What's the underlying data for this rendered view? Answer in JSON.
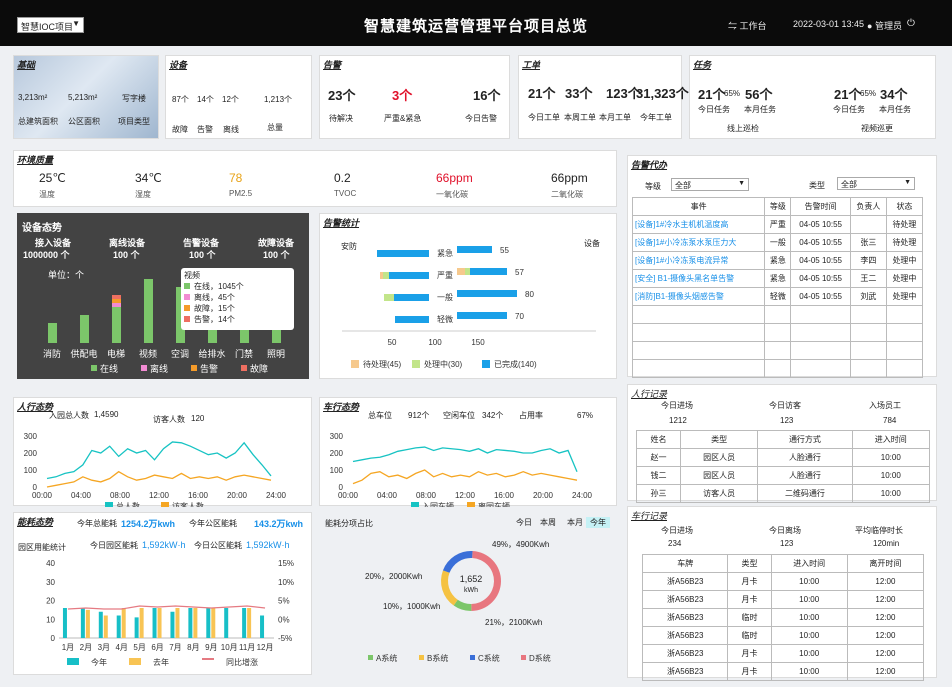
{
  "header": {
    "project": "智慧IOC项目",
    "title": "智慧建筑运营管理平台项目总览",
    "workbench": "工作台",
    "datetime": "2022-03-01 13:45",
    "user": "管理员"
  },
  "basic": {
    "title": "基础",
    "area_total": "3,213m²",
    "area_public": "5,213m²",
    "type": "写字楼",
    "l_total": "总建筑面积",
    "l_public": "公区面积",
    "l_type": "项目类型"
  },
  "device": {
    "title": "设备",
    "v1": "87个",
    "v2": "14个",
    "v3": "12个",
    "v4": "1,213个",
    "l1": "故障",
    "l2": "告警",
    "l3": "离线",
    "l4": "总量"
  },
  "alarm": {
    "title": "告警",
    "v1": "23个",
    "v2": "3个",
    "v3": "16个",
    "l1": "待解决",
    "l2": "严重&紧急",
    "l3": "今日告警"
  },
  "workorder": {
    "title": "工单",
    "v1": "21个",
    "v2": "33个",
    "v3": "123个",
    "v4": "31,323个",
    "l1": "今日工单",
    "l2": "本周工单",
    "l3": "本月工单",
    "l4": "今年工单"
  },
  "task": {
    "title": "任务",
    "a1": "21个",
    "ap": "65%",
    "a2": "56个",
    "al1": "今日任务",
    "al2": "本月任务",
    "acap": "线上巡检",
    "b1": "21个",
    "bp": "65%",
    "b2": "34个",
    "bl1": "今日任务",
    "bl2": "本月任务",
    "bcap": "视频巡更"
  },
  "env": {
    "title": "环境质量",
    "items": [
      {
        "v": "25℃",
        "l": "温度",
        "c": "#222"
      },
      {
        "v": "34℃",
        "l": "湿度",
        "c": "#222"
      },
      {
        "v": "78",
        "l": "PM2.5",
        "c": "#e8a317"
      },
      {
        "v": "0.2",
        "l": "TVOC",
        "c": "#222"
      },
      {
        "v": "66ppm",
        "l": "一氧化碳",
        "c": "#e0102a"
      },
      {
        "v": "66ppm",
        "l": "二氧化碳",
        "c": "#222"
      }
    ]
  },
  "devstatus": {
    "title": "设备态势",
    "k1": "接入设备",
    "k2": "离线设备",
    "k3": "告警设备",
    "k4": "故障设备",
    "v1": "1000000 个",
    "v2": "100 个",
    "v3": "100 个",
    "v4": "100 个",
    "unit": "单位：个",
    "tooltip": {
      "title": "视频",
      "rows": [
        "在线，1045个",
        "离线，45个",
        "故障，15个",
        "告警，14个"
      ]
    },
    "legend": [
      "在线",
      "离线",
      "告警",
      "故障"
    ],
    "colors": [
      "#7cc66a",
      "#f28bd3",
      "#f59b2a",
      "#ee6f61"
    ]
  },
  "alarmstats": {
    "title": "告警统计",
    "left": "安防",
    "right": "设备",
    "levels": [
      "紧急",
      "严重",
      "一般",
      "轻微"
    ],
    "right_values": [
      "55",
      "57",
      "80",
      "70"
    ],
    "axis": [
      "50",
      "100",
      "150"
    ],
    "legend": [
      "待处理(45)",
      "处理中(30)",
      "已完成(140)"
    ],
    "colors": [
      "#f6c98d",
      "#c2e58a",
      "#1aa0e8"
    ]
  },
  "todo": {
    "title": "告警代办",
    "f1": "等级",
    "f1v": "全部",
    "f2": "类型",
    "f2v": "全部",
    "cols": [
      "事件",
      "等级",
      "告警时间",
      "负责人",
      "状态"
    ],
    "rows": [
      [
        "[设备]1#冷水主机机温度高",
        "严重",
        "04-05 10:55",
        "",
        "待处理"
      ],
      [
        "[设备]1#小冷冻泵水泵压力大",
        "一般",
        "04-05 10:55",
        "张三",
        "待处理"
      ],
      [
        "[设备]1#小冷冻泵电流异常",
        "紧急",
        "04-05 10:55",
        "李四",
        "处理中"
      ],
      [
        "[安全] B1-摄像头黑名单告警",
        "紧急",
        "04-05 10:55",
        "王二",
        "处理中"
      ],
      [
        "[消防]B1-摄像头烟感告警",
        "轻微",
        "04-05 10:55",
        "刘武",
        "处理中"
      ]
    ]
  },
  "people": {
    "title": "人行态势",
    "total_label": "入园总人数",
    "total": "1,4590",
    "visit_label": "访客人数",
    "visit": "120",
    "yticks": [
      "300",
      "200",
      "100",
      "0"
    ],
    "xticks": [
      "00:00",
      "04:00",
      "08:00",
      "12:00",
      "16:00",
      "20:00",
      "24:00"
    ],
    "legend": [
      "总人数",
      "访客人数"
    ]
  },
  "vehicle": {
    "title": "车行态势",
    "total_label": "总车位",
    "total": "912个",
    "free_label": "空闲车位",
    "free": "342个",
    "rate_label": "占用率",
    "rate": "67%",
    "yticks": [
      "300",
      "200",
      "100",
      "0"
    ],
    "xticks": [
      "00:00",
      "04:00",
      "08:00",
      "12:00",
      "16:00",
      "20:00",
      "24:00"
    ],
    "legend": [
      "入园车辆",
      "离园车辆"
    ]
  },
  "energy": {
    "title": "能耗态势",
    "yl": "今年总能耗",
    "yv": "1254.2万kwh",
    "pl": "今年公区能耗",
    "pv": "143.2万kwh",
    "sub": "园区用能统计",
    "tl": "今日园区能耗",
    "tv": "1,592kW·h",
    "tpl": "今日公区能耗",
    "tpv": "1,592kW·h",
    "yticks": [
      "40",
      "30",
      "20",
      "10",
      "0"
    ],
    "rticks": [
      "15%",
      "10%",
      "5%",
      "0%",
      "-5%"
    ],
    "months": [
      "1月",
      "2月",
      "3月",
      "4月",
      "5月",
      "6月",
      "7月",
      "8月",
      "9月",
      "10月",
      "11月",
      "12月"
    ],
    "legend": [
      "今年",
      "去年",
      "同比增涨"
    ]
  },
  "split": {
    "title": "能耗分项占比",
    "tabs": [
      "今日",
      "本周",
      "本月",
      "今年"
    ],
    "center": "1,652",
    "unit": "kWh",
    "l1": "49%，4900Kwh",
    "l2": "20%，2000Kwh",
    "l3": "10%，1000Kwh",
    "l4": "21%，2100Kwh",
    "legend": [
      "A系统",
      "B系统",
      "C系统",
      "D系统"
    ],
    "colors": [
      "#7cc66a",
      "#f5c242",
      "#3a6fd8",
      "#e8767f"
    ]
  },
  "peoplerec": {
    "title": "人行记录",
    "k1": "今日进场",
    "k2": "今日访客",
    "k3": "入场员工",
    "v1": "1212",
    "v2": "123",
    "v3": "784",
    "cols": [
      "姓名",
      "类型",
      "通行方式",
      "进入时间"
    ],
    "rows": [
      [
        "赵一",
        "园区人员",
        "人脸通行",
        "10:00"
      ],
      [
        "钱二",
        "园区人员",
        "人脸通行",
        "10:00"
      ],
      [
        "孙三",
        "访客人员",
        "二维码通行",
        "10:00"
      ]
    ]
  },
  "carrec": {
    "title": "车行记录",
    "k1": "今日进场",
    "k2": "今日离场",
    "k3": "平均临停时长",
    "v1": "234",
    "v2": "123",
    "v3": "120min",
    "cols": [
      "车牌",
      "类型",
      "进入时间",
      "离开时间"
    ],
    "rows": [
      [
        "浙A56B23",
        "月卡",
        "10:00",
        "12:00"
      ],
      [
        "浙A56B23",
        "月卡",
        "10:00",
        "12:00"
      ],
      [
        "浙A56B23",
        "临时",
        "10:00",
        "12:00"
      ],
      [
        "浙A56B23",
        "临时",
        "10:00",
        "12:00"
      ],
      [
        "浙A56B23",
        "月卡",
        "10:00",
        "12:00"
      ],
      [
        "浙A56B23",
        "月卡",
        "10:00",
        "12:00"
      ]
    ]
  },
  "chart_data": [
    {
      "type": "bar",
      "name": "设备态势",
      "categories": [
        "消防",
        "供配电",
        "电梯",
        "视频",
        "空调",
        "给排水",
        "门禁",
        "照明"
      ],
      "series": [
        {
          "name": "在线",
          "values": [
            10,
            14,
            18,
            32,
            28,
            22,
            14,
            12
          ]
        },
        {
          "name": "离线",
          "values": [
            0,
            0,
            2,
            0,
            0,
            0,
            0,
            0
          ]
        },
        {
          "name": "告警",
          "values": [
            0,
            0,
            2,
            0,
            0,
            0,
            0,
            0
          ]
        },
        {
          "name": "故障",
          "values": [
            0,
            0,
            2,
            0,
            0,
            0,
            0,
            0
          ]
        }
      ]
    },
    {
      "type": "bar",
      "name": "告警统计",
      "categories": [
        "紧急",
        "严重",
        "一般",
        "轻微"
      ],
      "series": [
        {
          "name": "已完成(140)",
          "values": [
            55,
            57,
            80,
            70
          ]
        }
      ]
    },
    {
      "type": "line",
      "name": "人行态势",
      "series": [
        {
          "name": "总人数",
          "values": [
            50,
            60,
            80,
            90,
            130,
            215,
            200,
            240,
            180,
            225,
            200,
            215,
            160,
            225,
            265,
            260,
            240,
            215,
            190,
            200,
            170,
            200,
            260,
            190,
            130,
            65
          ]
        },
        {
          "name": "访客人数",
          "values": [
            0,
            10,
            20,
            30,
            60,
            40,
            30,
            50,
            90,
            60,
            40,
            50,
            70,
            60,
            50,
            80,
            50,
            60,
            50,
            60,
            40,
            60,
            70,
            60,
            50,
            40
          ]
        }
      ]
    },
    {
      "type": "line",
      "name": "车行态势",
      "series": [
        {
          "name": "入园车辆",
          "values": [
            150,
            160,
            170,
            175,
            190,
            210,
            220,
            230,
            235,
            215,
            230,
            225,
            220,
            210,
            225,
            200,
            220,
            215,
            210,
            200,
            200,
            215,
            225,
            200,
            215,
            90
          ]
        },
        {
          "name": "离园车辆",
          "values": [
            20,
            40,
            80,
            90,
            60,
            70,
            50,
            80,
            100,
            60,
            80,
            60,
            70,
            60,
            90,
            70,
            80,
            60,
            70,
            90,
            70,
            80,
            70,
            60,
            50,
            40
          ]
        }
      ]
    },
    {
      "type": "bar",
      "name": "园区用能统计",
      "categories": [
        "1月",
        "2月",
        "3月",
        "4月",
        "5月",
        "6月",
        "7月",
        "8月",
        "9月",
        "10月",
        "11月",
        "12月"
      ],
      "series": [
        {
          "name": "今年",
          "values": [
            16,
            16,
            14,
            12,
            11,
            16,
            14,
            16,
            16,
            16,
            16,
            12
          ]
        },
        {
          "name": "去年",
          "values": [
            0,
            15,
            12,
            16,
            16,
            16,
            16,
            16,
            16,
            0,
            16,
            0
          ]
        }
      ]
    },
    {
      "type": "pie",
      "name": "能耗分项占比",
      "categories": [
        "A系统",
        "B系统",
        "C系统",
        "D系统"
      ],
      "values": [
        10,
        21,
        20,
        49
      ]
    }
  ]
}
